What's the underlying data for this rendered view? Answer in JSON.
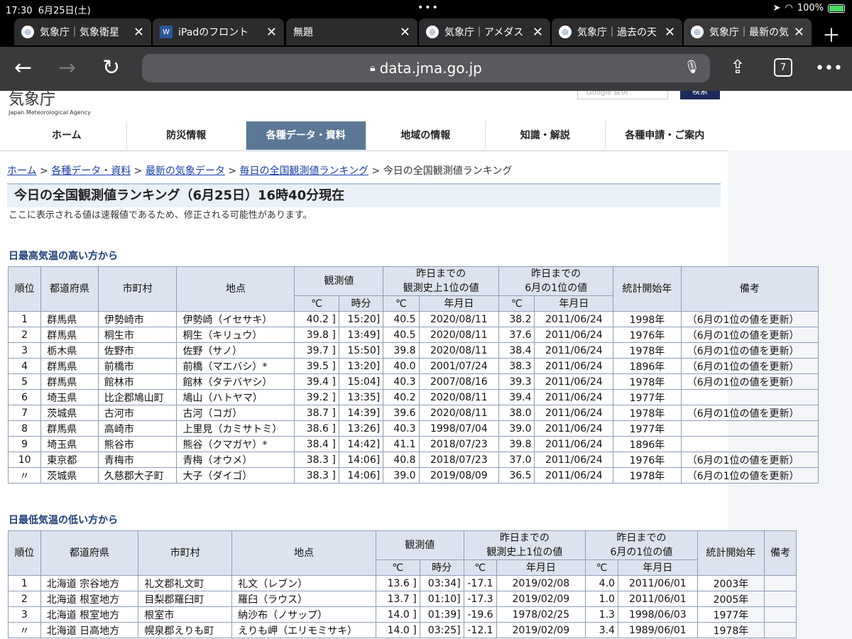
{
  "status": {
    "time": "17:30",
    "date": "6月25日(土)",
    "battery": "100%"
  },
  "tabs": [
    {
      "title": "気象庁｜気象衛星",
      "icon": "jma-favicon-icon"
    },
    {
      "title": "iPadのフロント",
      "icon": "word-favicon-icon"
    },
    {
      "title": "無題",
      "icon": "note-favicon-icon"
    },
    {
      "title": "気象庁｜アメダス",
      "icon": "jma-favicon-icon"
    },
    {
      "title": "気象庁｜過去の天",
      "icon": "jma-favicon-icon"
    },
    {
      "title": "気象庁｜最新の気",
      "icon": "jma-favicon-icon"
    }
  ],
  "browser": {
    "url": "data.jma.go.jp",
    "tab_count": "7"
  },
  "header": {
    "logo_jp": "気象庁",
    "logo_en": "Japan Meteorological Agency",
    "search_placeholder": "Google 提供",
    "search_button": "検索"
  },
  "gnav": [
    "ホーム",
    "防災情報",
    "各種データ・資料",
    "地域の情報",
    "知識・解説",
    "各種申請・ご案内"
  ],
  "breadcrumb": {
    "links": [
      "ホーム",
      "各種データ・資料",
      "最新の気象データ",
      "毎日の全国観測値ランキング"
    ],
    "current": "今日の全国観測値ランキング",
    "sep": " > "
  },
  "title": "今日の全国観測値ランキング（6月25日）16時40分現在",
  "notice": "ここに表示される値は速報値であるため、修正される可能性があります。",
  "high": {
    "heading": "日最高気温の高い方から",
    "headers": {
      "rank": "順位",
      "pref": "都道府県",
      "city": "市町村",
      "point": "地点",
      "obs": "観測値",
      "hist": "昨日までの\n観測史上1位の値",
      "june": "昨日までの\n6月の1位の値",
      "start": "統計開始年",
      "note": "備考",
      "deg": "℃",
      "time": "時分",
      "ymd": "年月日"
    },
    "rows": [
      [
        "1",
        "群馬県",
        "伊勢崎市",
        "伊勢崎（イセサキ）",
        "40.2 ]",
        "15:20]",
        "40.5",
        "2020/08/11",
        "38.2",
        "2011/06/24",
        "1998年",
        "（6月の1位の値を更新）"
      ],
      [
        "2",
        "群馬県",
        "桐生市",
        "桐生（キリュウ）",
        "39.8 ]",
        "13:49]",
        "40.5",
        "2020/08/11",
        "37.6",
        "2011/06/24",
        "1976年",
        "（6月の1位の値を更新）"
      ],
      [
        "3",
        "栃木県",
        "佐野市",
        "佐野（サノ）",
        "39.7 ]",
        "15:50]",
        "39.8",
        "2020/08/11",
        "38.4",
        "2011/06/24",
        "1978年",
        "（6月の1位の値を更新）"
      ],
      [
        "4",
        "群馬県",
        "前橋市",
        "前橋（マエバシ）*",
        "39.5 ]",
        "13:20]",
        "40.0",
        "2001/07/24",
        "38.3",
        "2011/06/24",
        "1896年",
        "（6月の1位の値を更新）"
      ],
      [
        "5",
        "群馬県",
        "館林市",
        "館林（タテバヤシ）",
        "39.4 ]",
        "15:04]",
        "40.3",
        "2007/08/16",
        "39.3",
        "2011/06/24",
        "1978年",
        "（6月の1位の値を更新）"
      ],
      [
        "6",
        "埼玉県",
        "比企郡鳩山町",
        "鳩山（ハトヤマ）",
        "39.2 ]",
        "13:35]",
        "40.2",
        "2020/08/11",
        "39.4",
        "2011/06/24",
        "1977年",
        ""
      ],
      [
        "7",
        "茨城県",
        "古河市",
        "古河（コガ）",
        "38.7 ]",
        "14:39]",
        "39.6",
        "2020/08/11",
        "38.0",
        "2011/06/24",
        "1978年",
        "（6月の1位の値を更新）"
      ],
      [
        "8",
        "群馬県",
        "高崎市",
        "上里見（カミサトミ）",
        "38.6 ]",
        "13:26]",
        "40.3",
        "1998/07/04",
        "39.0",
        "2011/06/24",
        "1977年",
        ""
      ],
      [
        "9",
        "埼玉県",
        "熊谷市",
        "熊谷（クマガヤ）*",
        "38.4 ]",
        "14:42]",
        "41.1",
        "2018/07/23",
        "39.8",
        "2011/06/24",
        "1896年",
        ""
      ],
      [
        "10",
        "東京都",
        "青梅市",
        "青梅（オウメ）",
        "38.3 ]",
        "14:06]",
        "40.8",
        "2018/07/23",
        "37.0",
        "2011/06/24",
        "1976年",
        "（6月の1位の値を更新）"
      ],
      [
        "〃",
        "茨城県",
        "久慈郡大子町",
        "大子（ダイゴ）",
        "38.3 ]",
        "14:06]",
        "39.0",
        "2019/08/09",
        "36.5",
        "2011/06/24",
        "1978年",
        "（6月の1位の値を更新）"
      ]
    ]
  },
  "low": {
    "heading": "日最低気温の低い方から",
    "rows": [
      [
        "1",
        "北海道 宗谷地方",
        "礼文郡礼文町",
        "礼文（レブン）",
        "13.6 ]",
        "03:34]",
        "-17.1",
        "2019/02/08",
        "4.0",
        "2011/06/01",
        "2003年",
        ""
      ],
      [
        "2",
        "北海道 根室地方",
        "目梨郡羅臼町",
        "羅臼（ラウス）",
        "13.7 ]",
        "01:10]",
        "-17.3",
        "2019/02/09",
        "1.0",
        "2011/06/01",
        "2005年",
        ""
      ],
      [
        "3",
        "北海道 根室地方",
        "根室市",
        "納沙布（ノサップ）",
        "14.0 ]",
        "01:39]",
        "-19.6",
        "1978/02/25",
        "1.3",
        "1998/06/03",
        "1977年",
        ""
      ],
      [
        "〃",
        "北海道 日高地方",
        "幌泉郡えりも町",
        "えりも岬（エリモミサキ）",
        "14.0 ]",
        "03:25]",
        "-12.1",
        "2019/02/09",
        "3.4",
        "1989/06/01",
        "1978年",
        ""
      ]
    ]
  }
}
